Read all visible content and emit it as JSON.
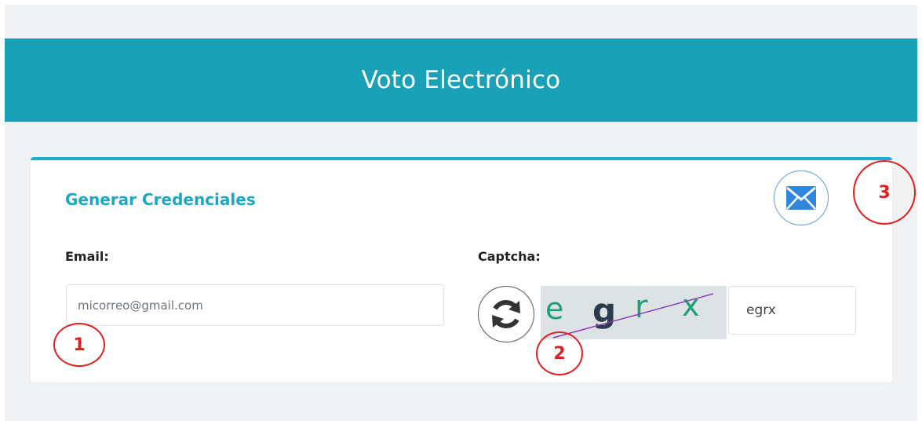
{
  "header": {
    "title": "Voto Electrónico"
  },
  "card": {
    "title": "Generar Credenciales",
    "email": {
      "label": "Email:",
      "placeholder": "micorreo@gmail.com",
      "value": ""
    },
    "captcha": {
      "label": "Captcha:",
      "image_text": [
        "e",
        "g",
        "r",
        "x"
      ],
      "input_value": "egrx"
    },
    "send_button_icon": "envelope-icon",
    "refresh_button_icon": "refresh-icon"
  },
  "annotations": [
    "1",
    "2",
    "3"
  ],
  "colors": {
    "banner": "#1aa1b8",
    "card_title": "#1aa9c4",
    "card_border": "#1ab0cc",
    "mail_icon": "#2f86de",
    "annotation": "#e02020",
    "captcha_green": "#1e9e79",
    "captcha_dark": "#2a3b4a",
    "captcha_line": "#8a3fb8"
  }
}
